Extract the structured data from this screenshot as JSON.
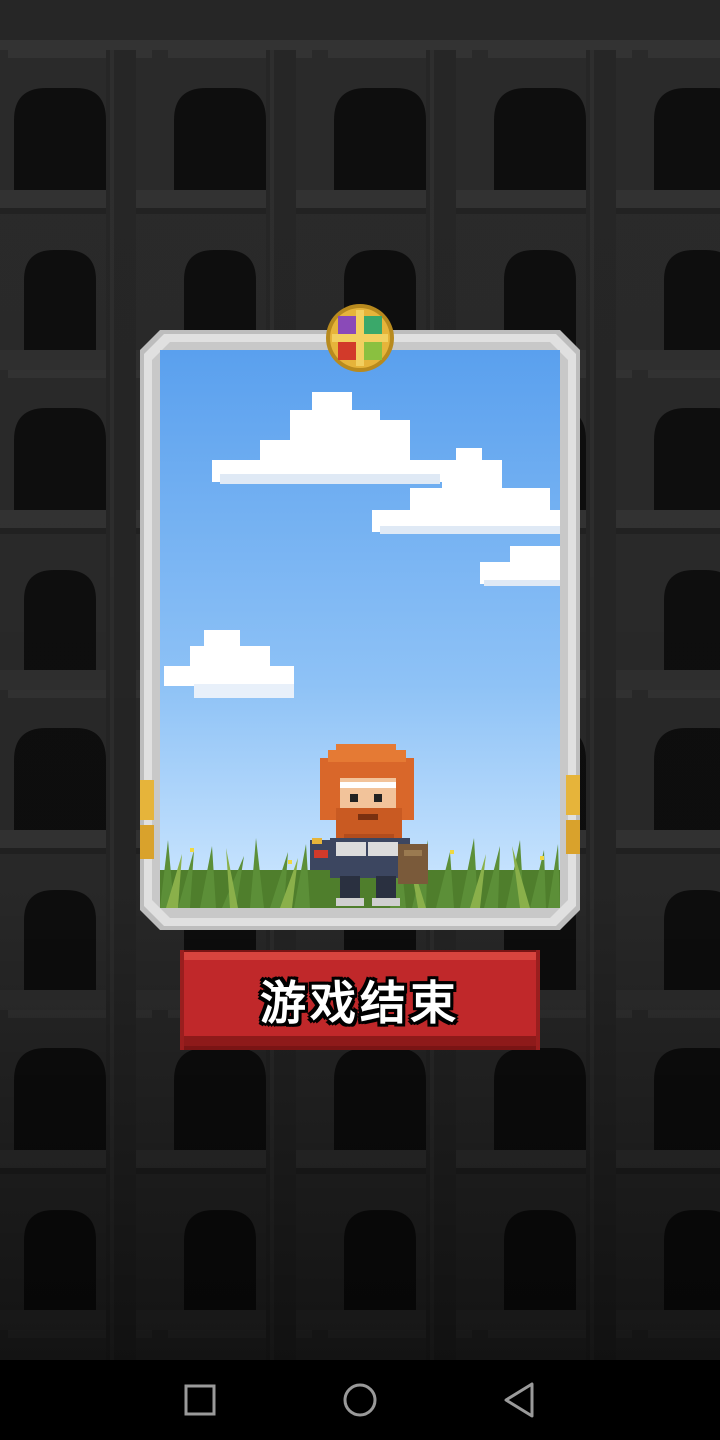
{
  "game": {
    "end_button_label": "游戏结束"
  },
  "card": {
    "character": "red-bearded-warrior",
    "scene": "sky-with-clouds-and-grass"
  },
  "navigation_bar": {
    "buttons": [
      "recent-apps",
      "home",
      "back"
    ]
  },
  "colors": {
    "background": "#1b1b1b",
    "sky_top": "#5aa0ee",
    "sky_bottom": "#cfe8ff",
    "card_frame": "#cfcfcf",
    "button_red": "#c0282a",
    "emblem_gold": "#e6b43a",
    "navbar": "#000000"
  }
}
